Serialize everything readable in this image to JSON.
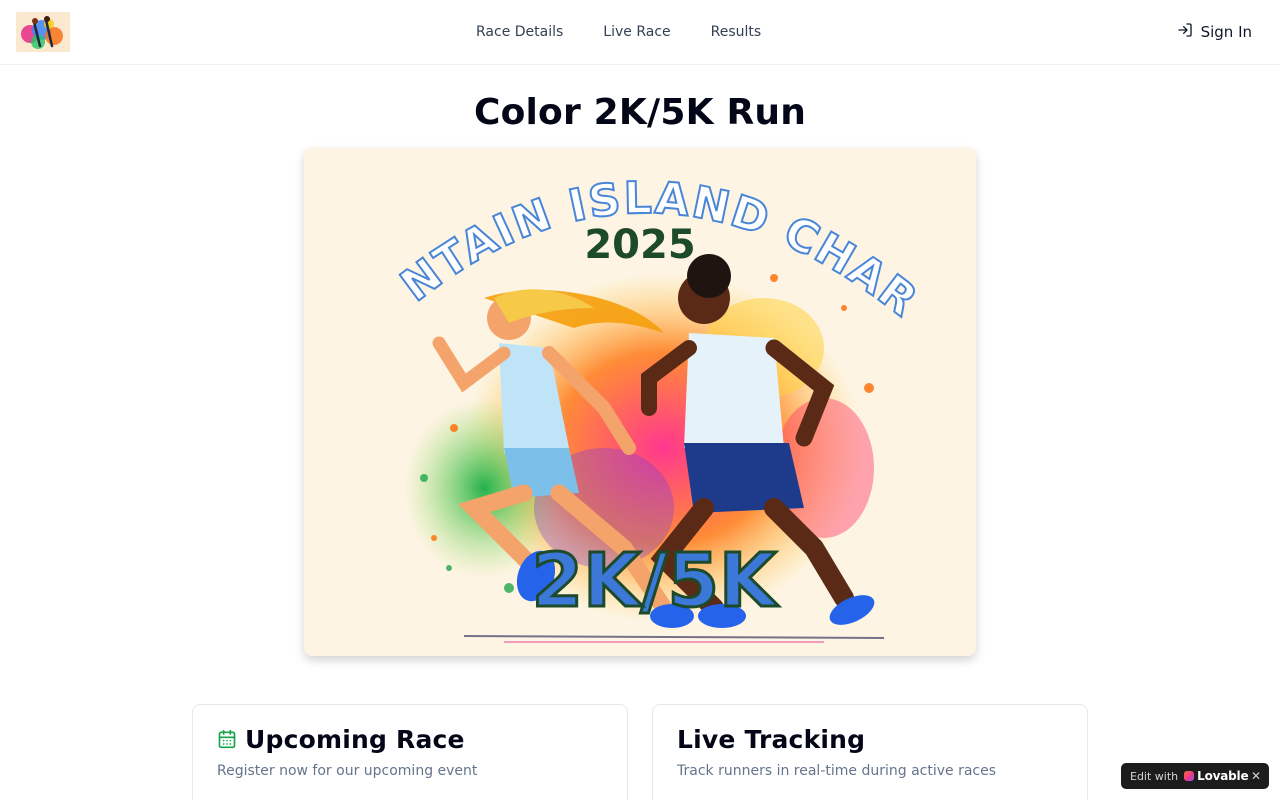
{
  "header": {
    "logo_alt": "Color Run logo",
    "nav": [
      "Race Details",
      "Live Race",
      "Results"
    ],
    "signin_label": "Sign In"
  },
  "page": {
    "title": "Color 2K/5K Run"
  },
  "hero": {
    "arc_text": "MOUNTAIN ISLAND CHARTER",
    "year": "2025",
    "distance": "2K/5K"
  },
  "cards": {
    "upcoming": {
      "title": "Upcoming Race",
      "subtitle": "Register now for our upcoming event"
    },
    "live": {
      "title": "Live Tracking",
      "subtitle": "Track runners in real-time during active races"
    }
  },
  "badge": {
    "prefix": "Edit with",
    "brand": "Lovable",
    "close": "✕"
  },
  "colors": {
    "accent_green": "#16a34a",
    "hero_bg": "#fdf4e3",
    "arc_blue": "#4a86d8",
    "year_green": "#1d4a2a"
  }
}
